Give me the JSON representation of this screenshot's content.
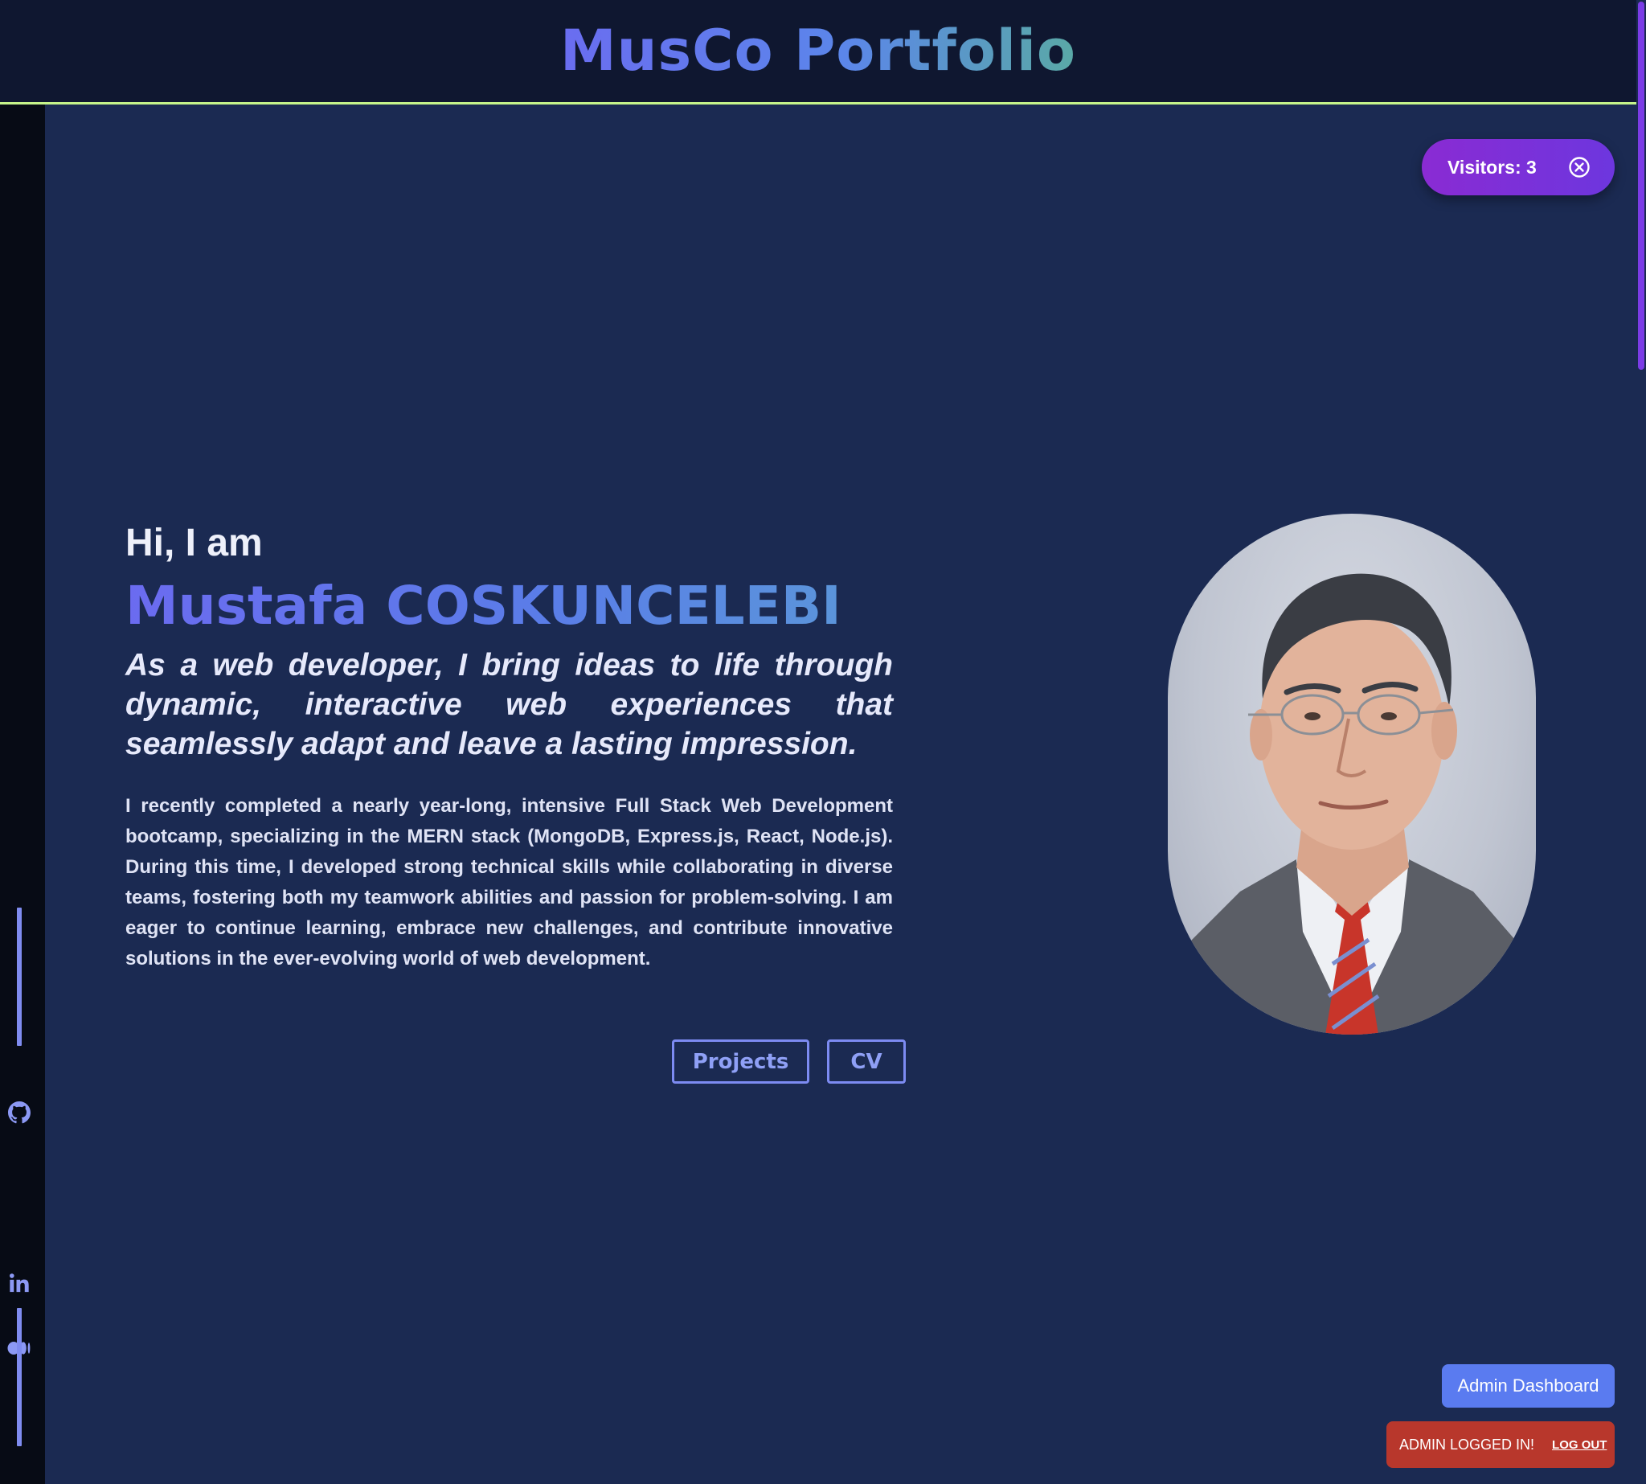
{
  "header": {
    "title": "MusCo Portfolio"
  },
  "visitors": {
    "label": "Visitors: 3",
    "close_icon": "close-circle-icon"
  },
  "sidebar": {
    "links": [
      {
        "icon": "github-icon",
        "label": "GitHub"
      },
      {
        "icon": "linkedin-icon",
        "label": "LinkedIn"
      },
      {
        "icon": "medium-icon",
        "label": "Medium"
      }
    ]
  },
  "hero": {
    "greeting": "Hi, I am",
    "name": "Mustafa COSKUNCELEBI",
    "tagline": "As a web developer, I bring ideas to life through dynamic, interactive web experiences that seamlessly adapt and leave a lasting impression.",
    "bio": "I recently completed a nearly year-long, intensive Full Stack Web Development bootcamp, specializing in the MERN stack (MongoDB, Express.js, React, Node.js). During this time, I developed strong technical skills while collaborating in diverse teams, fostering both my teamwork abilities and passion for problem-solving. I am eager to continue learning, embrace new challenges, and contribute innovative solutions in the ever-evolving world of web development.",
    "projects_label": "Projects",
    "cv_label": "CV"
  },
  "admin": {
    "dashboard_label": "Admin Dashboard",
    "status_text": "ADMIN LOGGED IN!",
    "logout_label": "LOG OUT"
  },
  "colors": {
    "background": "#1b2a52",
    "header": "#0f1730",
    "accent": "#7d8bf2",
    "visitors_pill": "#8a2bd3",
    "admin_button": "#5a7bf0",
    "admin_banner": "#b8372c"
  }
}
